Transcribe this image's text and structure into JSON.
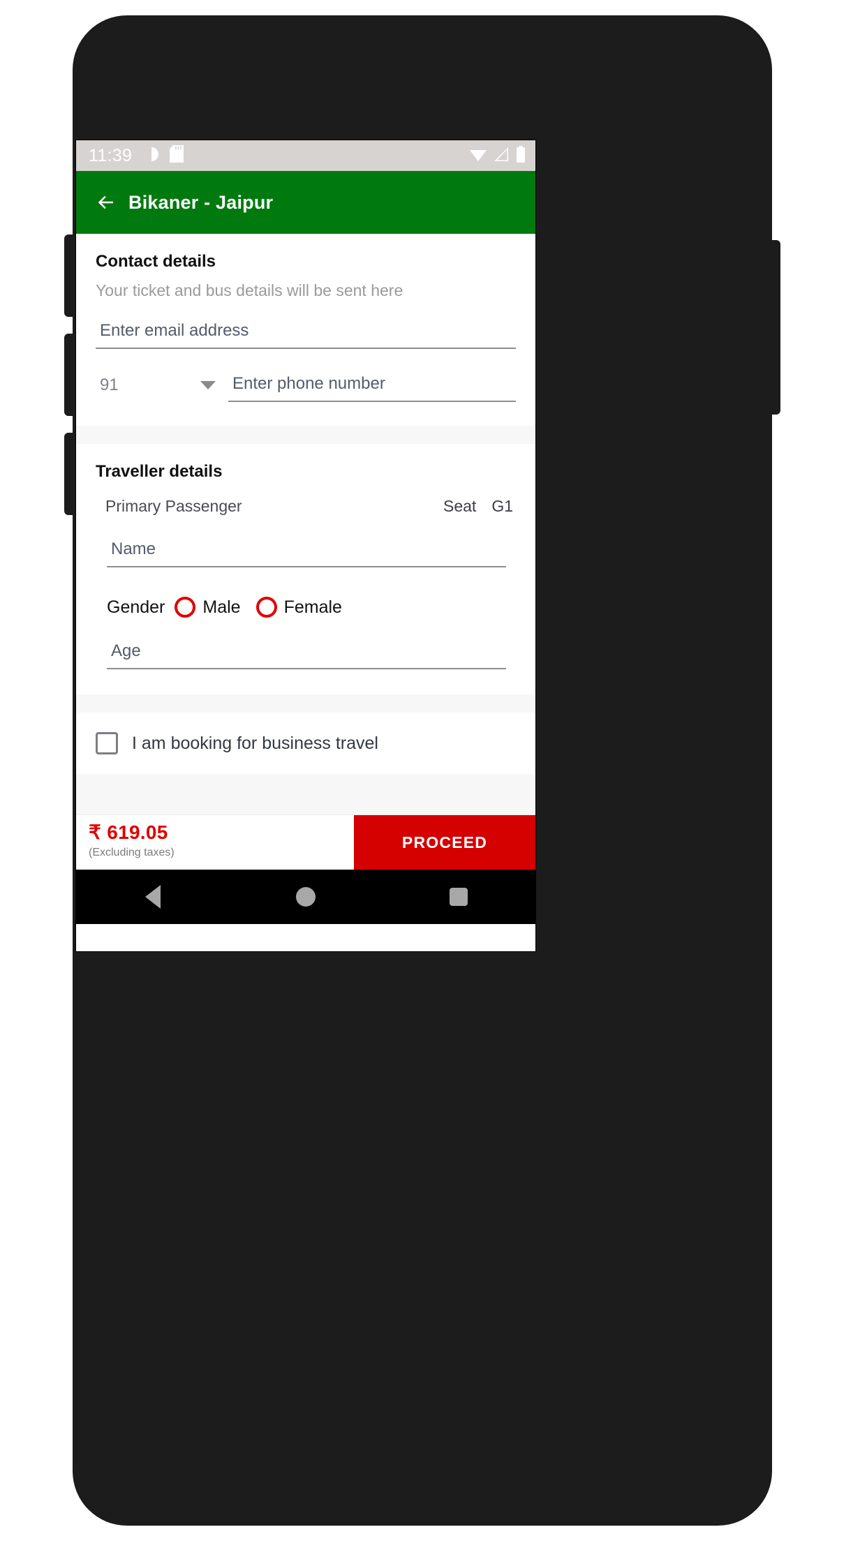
{
  "status_bar": {
    "time": "11:39",
    "left_icons": [
      "alarm-icon",
      "sd-card-icon"
    ],
    "right_icons": [
      "wifi-icon",
      "cellular-signal-icon",
      "battery-icon"
    ]
  },
  "app_bar": {
    "back_icon": "back-arrow-icon",
    "title": "Bikaner - Jaipur",
    "background_color": "#007A0E"
  },
  "contact": {
    "section_title": "Contact details",
    "section_subtitle": "Your ticket and bus details will be sent here",
    "email_placeholder": "Enter email address",
    "email_value": "",
    "country_code": "91",
    "phone_placeholder": "Enter phone number",
    "phone_value": ""
  },
  "traveller": {
    "section_title": "Traveller details",
    "passenger_label": "Primary Passenger",
    "seat_label": "Seat",
    "seat_number": "G1",
    "name_placeholder": "Name",
    "name_value": "",
    "gender_label": "Gender",
    "gender_options": [
      "Male",
      "Female"
    ],
    "gender_selected": "",
    "age_placeholder": "Age",
    "age_value": "",
    "radio_color": "#E00000"
  },
  "business": {
    "checkbox_label": "I am booking for business travel",
    "checked": false
  },
  "bottom_bar": {
    "fare_amount": "₹ 619.05",
    "fare_note": "(Excluding taxes)",
    "fare_color": "#E00000",
    "proceed_label": "PROCEED",
    "proceed_color": "#D50000"
  },
  "nav_bar": {
    "back": "nav-back-icon",
    "home": "nav-home-icon",
    "recents": "nav-recents-icon"
  }
}
